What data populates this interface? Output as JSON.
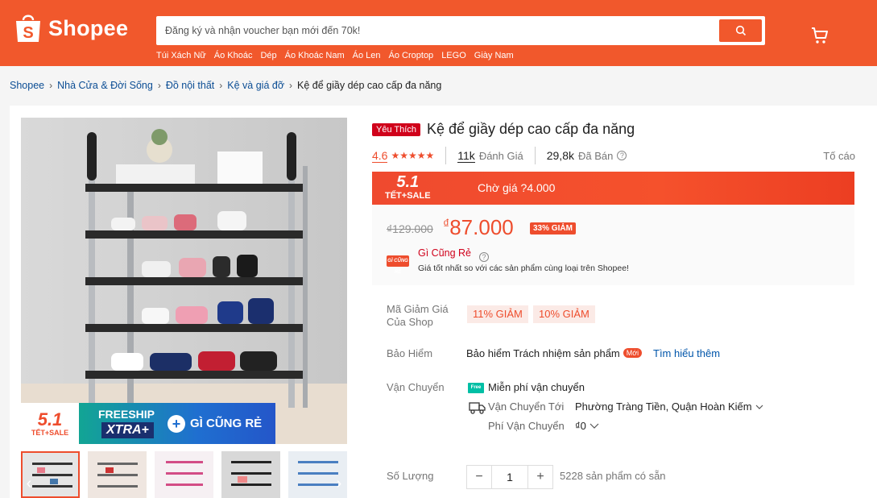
{
  "brand": {
    "name": "Shopee",
    "accent": "#f1582c",
    "primary": "#ee4d2d"
  },
  "header": {
    "search_placeholder": "Đăng ký và nhận voucher bạn mới đến 70k!",
    "hot_keywords": [
      "Túi Xách Nữ",
      "Áo Khoác",
      "Dép",
      "Áo Khoác Nam",
      "Áo Len",
      "Áo Croptop",
      "LEGO",
      "Giày Nam"
    ]
  },
  "breadcrumb": {
    "items": [
      "Shopee",
      "Nhà Cửa & Đời Sống",
      "Đồ nội thất",
      "Kệ và giá đỡ"
    ],
    "current": "Kệ để giầy dép cao cấp đa năng"
  },
  "gallery": {
    "promo_51": "5.1",
    "promo_tet_sale": "TẾT+SALE",
    "promo_freeship": "FREESHIP",
    "promo_xtra": "XTRA+",
    "promo_gi_cung_re": "GÌ CŨNG RẺ",
    "thumbnail_count": 5
  },
  "product": {
    "badge": "Yêu Thích",
    "title": "Kệ để giầy dép cao cấp đa năng",
    "rating": "4.6",
    "stars": "★★★★★",
    "reviews_count": "11k",
    "reviews_label": "Đánh Giá",
    "sold_count": "29,8k",
    "sold_label": "Đã Bán",
    "report_label": "Tố cáo"
  },
  "flash_sale": {
    "logo_big": "5.1",
    "logo_small": "TẾT+SALE",
    "text": "Chờ giá ?4.000"
  },
  "price": {
    "original": "₫129.000",
    "currency": "₫",
    "current": "87.000",
    "discount": "33% GIẢM",
    "gcr_icon": "GÌ CŨNG RẺ",
    "gcr_title": "Gì Cũng Rẻ",
    "gcr_desc": "Giá tốt nhất so với các sản phẩm cùng loại trên Shopee!"
  },
  "vouchers": {
    "label_line1": "Mã Giảm Giá",
    "label_line2": "Của Shop",
    "tags": [
      "11% GIẢM",
      "10% GIẢM"
    ]
  },
  "insurance": {
    "label": "Bảo Hiểm",
    "text": "Bảo hiểm Trách nhiệm sản phẩm",
    "new_badge": "Mới",
    "link": "Tìm hiểu thêm"
  },
  "shipping": {
    "label": "Vận Chuyển",
    "free_badge": "Free",
    "free_text": "Miễn phí vận chuyển",
    "to_label": "Vận Chuyển Tới",
    "to_value": "Phường Tràng Tiền, Quận Hoàn Kiếm",
    "fee_label": "Phí Vận Chuyển",
    "fee_value": "₫0"
  },
  "quantity": {
    "label": "Số Lượng",
    "minus": "−",
    "value": "1",
    "plus": "+",
    "stock": "5228 sản phẩm có sẵn"
  }
}
